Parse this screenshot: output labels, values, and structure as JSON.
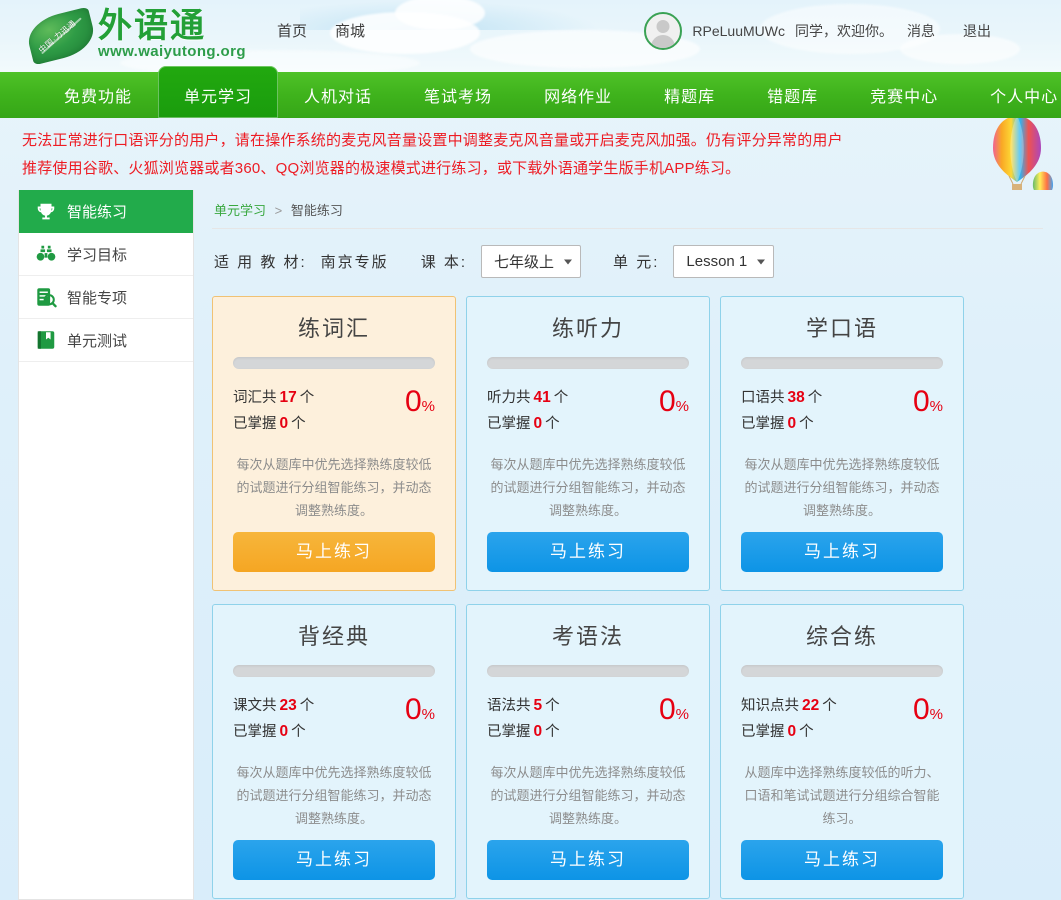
{
  "site": {
    "brand_name": "外语通",
    "brand_url": "www.waiyutong.org",
    "leaf_text": "中国·力迅通"
  },
  "header": {
    "top_links": [
      "首页",
      "商城"
    ],
    "user": {
      "name": "RPeLuuMUWc",
      "greeting": "同学，欢迎你。",
      "messages_label": "消息",
      "logout_label": "退出"
    }
  },
  "nav": {
    "items": [
      {
        "label": "免费功能",
        "active": false
      },
      {
        "label": "单元学习",
        "active": true
      },
      {
        "label": "人机对话",
        "active": false
      },
      {
        "label": "笔试考场",
        "active": false
      },
      {
        "label": "网络作业",
        "active": false
      },
      {
        "label": "精题库",
        "active": false
      },
      {
        "label": "错题库",
        "active": false
      },
      {
        "label": "竞赛中心",
        "active": false
      },
      {
        "label": "个人中心",
        "active": false
      }
    ]
  },
  "notice": {
    "line1": "无法正常进行口语评分的用户，请在操作系统的麦克风音量设置中调整麦克风音量或开启麦克风加强。仍有评分异常的用户",
    "line2": "推荐使用谷歌、火狐浏览器或者360、QQ浏览器的极速模式进行练习，或下载外语通学生版手机APP练习。",
    "color": "#ed1c24"
  },
  "sidebar": {
    "items": [
      {
        "label": "智能练习",
        "icon": "trophy-icon",
        "active": true
      },
      {
        "label": "学习目标",
        "icon": "binoculars-icon",
        "active": false
      },
      {
        "label": "智能专项",
        "icon": "document-search-icon",
        "active": false
      },
      {
        "label": "单元测试",
        "icon": "book-icon",
        "active": false
      }
    ]
  },
  "breadcrumb": {
    "root": "单元学习",
    "separator": ">",
    "current": "智能练习"
  },
  "filters": {
    "textbook_label": "适 用 教 材:",
    "textbook_value": "南京专版",
    "book_label": "课 本:",
    "book_value": "七年级上",
    "unit_label": "单 元:",
    "unit_value": "Lesson 1"
  },
  "cards": [
    {
      "title": "练词汇",
      "progress": 0,
      "total_label": "词汇共",
      "total_value": "17",
      "unit": "个",
      "mastered_label": "已掌握",
      "mastered_value": "0",
      "percent": "0",
      "percent_symbol": "%",
      "desc": "每次从题库中优先选择熟练度较低的试题进行分组智能练习，并动态调整熟练度。",
      "button": "马上练习",
      "theme": "warm"
    },
    {
      "title": "练听力",
      "progress": 0,
      "total_label": "听力共",
      "total_value": "41",
      "unit": "个",
      "mastered_label": "已掌握",
      "mastered_value": "0",
      "percent": "0",
      "percent_symbol": "%",
      "desc": "每次从题库中优先选择熟练度较低的试题进行分组智能练习，并动态调整熟练度。",
      "button": "马上练习",
      "theme": "cool"
    },
    {
      "title": "学口语",
      "progress": 0,
      "total_label": "口语共",
      "total_value": "38",
      "unit": "个",
      "mastered_label": "已掌握",
      "mastered_value": "0",
      "percent": "0",
      "percent_symbol": "%",
      "desc": "每次从题库中优先选择熟练度较低的试题进行分组智能练习，并动态调整熟练度。",
      "button": "马上练习",
      "theme": "cool"
    },
    {
      "title": "背经典",
      "progress": 0,
      "total_label": "课文共",
      "total_value": "23",
      "unit": "个",
      "mastered_label": "已掌握",
      "mastered_value": "0",
      "percent": "0",
      "percent_symbol": "%",
      "desc": "每次从题库中优先选择熟练度较低的试题进行分组智能练习，并动态调整熟练度。",
      "button": "马上练习",
      "theme": "cool"
    },
    {
      "title": "考语法",
      "progress": 0,
      "total_label": "语法共",
      "total_value": "5",
      "unit": "个",
      "mastered_label": "已掌握",
      "mastered_value": "0",
      "percent": "0",
      "percent_symbol": "%",
      "desc": "每次从题库中优先选择熟练度较低的试题进行分组智能练习，并动态调整熟练度。",
      "button": "马上练习",
      "theme": "cool"
    },
    {
      "title": "综合练",
      "progress": 0,
      "total_label": "知识点共",
      "total_value": "22",
      "unit": "个",
      "mastered_label": "已掌握",
      "mastered_value": "0",
      "percent": "0",
      "percent_symbol": "%",
      "desc": "从题库中选择熟练度较低的听力、口语和笔试试题进行分组综合智能练习。",
      "button": "马上练习",
      "theme": "cool"
    }
  ],
  "colors": {
    "nav_green": "#3fb31c",
    "active_green": "#19a313",
    "accent_red": "#e60012",
    "blue_button": "#0d94e6",
    "orange_button": "#f5a623"
  }
}
